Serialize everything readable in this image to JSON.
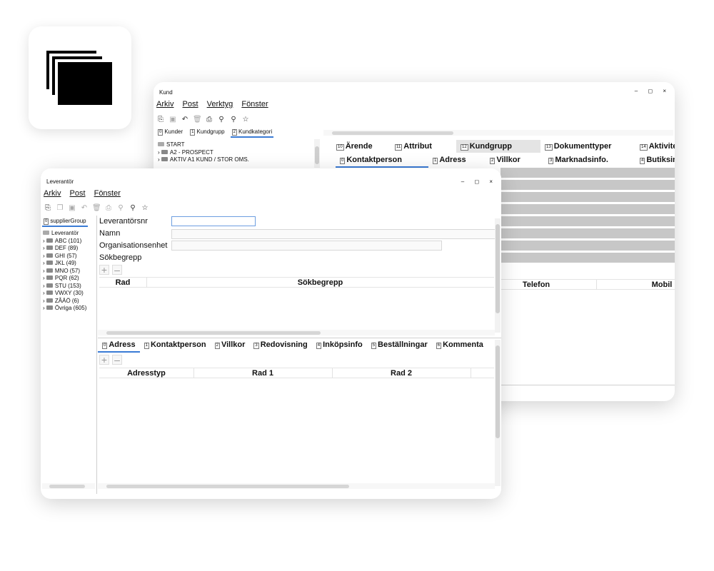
{
  "app_icon": {
    "name": "windows-stack-icon"
  },
  "bg_window": {
    "title": "Kund",
    "controls": "– ◻ ×",
    "menu": [
      "Arkiv",
      "Post",
      "Verktyg",
      "Fönster"
    ],
    "tabs": [
      {
        "num": "0",
        "label": "Kunder"
      },
      {
        "num": "1",
        "label": "Kundgrupp"
      },
      {
        "num": "2",
        "label": "Kundkategori"
      }
    ],
    "tree": [
      {
        "label": "START",
        "icon": "folder-open"
      },
      {
        "label": "A2 - PROSPECT",
        "icon": "folder"
      },
      {
        "label": "AKTIV A1 KUND / STOR OMS.",
        "icon": "folder"
      }
    ],
    "top_tabs": [
      {
        "num": "10",
        "label": "Ärende"
      },
      {
        "num": "11",
        "label": "Attribut"
      },
      {
        "num": "12",
        "label": "Kundgrupp"
      },
      {
        "num": "13",
        "label": "Dokumenttyper"
      },
      {
        "num": "14",
        "label": "Aktivitet"
      }
    ],
    "sub_tabs": [
      {
        "num": "0",
        "label": "Kontaktperson"
      },
      {
        "num": "1",
        "label": "Adress"
      },
      {
        "num": "2",
        "label": "Villkor"
      },
      {
        "num": "3",
        "label": "Marknadsinfo."
      },
      {
        "num": "4",
        "label": "Butiksin"
      }
    ],
    "columns": [
      "Telefon",
      "Mobil"
    ]
  },
  "fg_window": {
    "title": "Leverantör",
    "controls": "– ◻ ×",
    "menu": [
      "Arkiv",
      "Post",
      "Fönster"
    ],
    "left_tab": {
      "num": "0",
      "label": "supplierGroup"
    },
    "tree_root": "Leverantör",
    "tree": [
      {
        "label": "ABC (101)"
      },
      {
        "label": "DEF (89)"
      },
      {
        "label": "GHI (57)"
      },
      {
        "label": "JKL (49)"
      },
      {
        "label": "MNO (57)"
      },
      {
        "label": "PQR (62)"
      },
      {
        "label": "STU (153)"
      },
      {
        "label": "VWXY (30)"
      },
      {
        "label": "ZÅÄÖ (6)"
      },
      {
        "label": "Övriga (605)"
      }
    ],
    "form": {
      "supplier_no_label": "Leverantörsnr",
      "name_label": "Namn",
      "org_label": "Organisationsenhet",
      "search_label": "Sökbegrepp",
      "supplier_no_value": "",
      "name_value": "",
      "org_value": ""
    },
    "search_table": {
      "columns": [
        "Rad",
        "Sökbegrepp"
      ]
    },
    "bottom_tabs": [
      {
        "num": "0",
        "label": "Adress"
      },
      {
        "num": "1",
        "label": "Kontaktperson"
      },
      {
        "num": "2",
        "label": "Villkor"
      },
      {
        "num": "3",
        "label": "Redovisning"
      },
      {
        "num": "4",
        "label": "Inköpsinfo"
      },
      {
        "num": "5",
        "label": "Beställningar"
      },
      {
        "num": "6",
        "label": "Kommenta"
      }
    ],
    "address_table": {
      "columns": [
        "Adresstyp",
        "Rad 1",
        "Rad 2"
      ]
    },
    "plus": "+",
    "minus": "–"
  }
}
